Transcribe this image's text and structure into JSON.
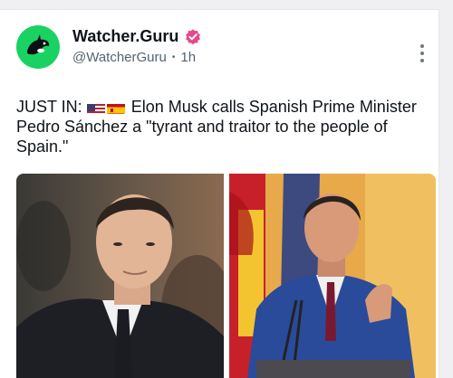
{
  "post": {
    "author": {
      "display_name": "Watcher.Guru",
      "handle": "@WatcherGuru",
      "time": "1h",
      "avatar_icon": "orca-logo-icon",
      "avatar_color": "#19d262",
      "verified_icon": "verified-badge-icon",
      "verified_color": "#e8478b"
    },
    "text_prefix": "JUST IN:",
    "flags": [
      "us-flag-icon",
      "spain-flag-icon"
    ],
    "text_body": "Elon Musk calls Spanish Prime Minister Pedro Sánchez a \"tyrant and traitor to the people of Spain.\"",
    "more_icon": "more-options-icon",
    "images": [
      "photo-elon-musk",
      "photo-pedro-sanchez"
    ]
  }
}
